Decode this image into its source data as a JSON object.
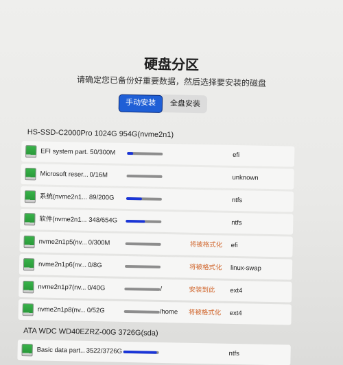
{
  "page": {
    "title": "硬盘分区",
    "subtitle": "请确定您已备份好重要数据，然后选择要安装的磁盘"
  },
  "mode": {
    "manual_label": "手动安装",
    "full_label": "全盘安装",
    "active": "manual"
  },
  "colors": {
    "accent": "#1f5fd6",
    "usage_fill": "#1a35d8",
    "usage_track": "#8d8d8d",
    "status_warning": "#d0642a",
    "drive_icon": "#39b54a"
  },
  "disks": [
    {
      "header": "HS-SSD-C2000Pro 1024G 954G(nvme2n1)",
      "partitions": [
        {
          "name": "EFI system part...",
          "size": "50/300M",
          "usage": 0.17,
          "mount": "",
          "status": "",
          "fs": "efi",
          "icon": "drive-icon"
        },
        {
          "name": "Microsoft reser...",
          "size": "0/16M",
          "usage": 0,
          "mount": "",
          "status": "",
          "fs": "unknown",
          "icon": "drive-icon"
        },
        {
          "name": "系统(nvme2n1...",
          "size": "89/200G",
          "usage": 0.45,
          "mount": "",
          "status": "",
          "fs": "ntfs",
          "icon": "drive-icon"
        },
        {
          "name": "软件(nvme2n1...",
          "size": "348/654G",
          "usage": 0.53,
          "mount": "",
          "status": "",
          "fs": "ntfs",
          "icon": "drive-icon"
        },
        {
          "name": "nvme2n1p5(nv...",
          "size": "0/300M",
          "usage": 0,
          "mount": "",
          "status": "将被格式化",
          "fs": "efi",
          "icon": "drive-icon"
        },
        {
          "name": "nvme2n1p6(nv...",
          "size": "0/8G",
          "usage": 0,
          "mount": "",
          "status": "将被格式化",
          "fs": "linux-swap",
          "icon": "drive-icon"
        },
        {
          "name": "nvme2n1p7(nv...",
          "size": "0/40G",
          "usage": 0,
          "mount": "/",
          "status": "安装到此",
          "fs": "ext4",
          "icon": "drive-icon"
        },
        {
          "name": "nvme2n1p8(nv...",
          "size": "0/52G",
          "usage": 0,
          "mount": "/home",
          "status": "将被格式化",
          "fs": "ext4",
          "icon": "drive-icon"
        }
      ]
    },
    {
      "header": "ATA WDC WD40EZRZ-00G 3726G(sda)",
      "partitions": [
        {
          "name": "Basic data part...",
          "size": "3522/3726G",
          "usage": 0.95,
          "mount": "",
          "status": "",
          "fs": "ntfs",
          "icon": "drive-icon"
        }
      ]
    }
  ]
}
